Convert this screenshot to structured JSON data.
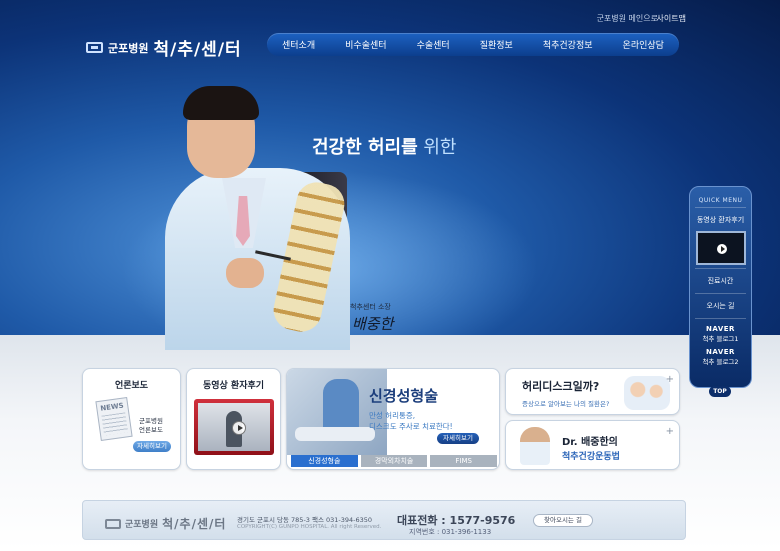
{
  "header": {
    "util_links": [
      "군포병원 메인으로",
      "사이트맵"
    ],
    "logo_hospital": "군포병원",
    "logo_center": "척/추/센/터"
  },
  "nav": {
    "items": [
      "센터소개",
      "비수술센터",
      "수술센터",
      "질환정보",
      "척추건강정보",
      "온라인상담"
    ]
  },
  "hero": {
    "headline_bold": "건강한 허리를",
    "headline_light": " 위한",
    "sign_title": "척추센터 소장",
    "sign_name": "배중한"
  },
  "quick_menu": {
    "title": "QUICK MENU",
    "video_label": "동영상 환자후기",
    "items": [
      "진료시간",
      "오시는 길"
    ],
    "naver": [
      {
        "brand": "NAVER",
        "label": "척추 블로그1"
      },
      {
        "brand": "NAVER",
        "label": "척추 블로그2"
      }
    ],
    "top": "TOP"
  },
  "boxes": {
    "press": {
      "title": "언론보도",
      "news_word": "NEWS",
      "desc_1": "군포병원",
      "desc_2": "언론보도",
      "button": "자세히보기"
    },
    "video": {
      "title": "동영상 환자후기"
    },
    "nerve": {
      "title": "신경성형술",
      "desc_1": "만성 허리통증,",
      "desc_2": "디스크도 주사로 치료한다!",
      "button": "자세히보기",
      "tabs": [
        "신경성형술",
        "경막외차치술",
        "FIMS"
      ]
    },
    "disc": {
      "title": "허리디스크일까?",
      "desc": "증상으로 알아보는 나의 질환은?"
    },
    "doctor": {
      "title": "Dr. 배중한의",
      "subtitle": "척추건강운동법"
    }
  },
  "footer": {
    "logo_hospital": "군포병원",
    "logo_center": "척/추/센/터",
    "address": "경기도 군포시 당동 785-3  팩스 031-394-6350",
    "copyright": "COPYRIGHT(C) GUNPO HOSPITAL. All right Reserved.",
    "phone": "대표전화 : 1577-9576",
    "local": "지역번호 : 031-396-1133",
    "directions_button": "찾아오시는 길"
  }
}
